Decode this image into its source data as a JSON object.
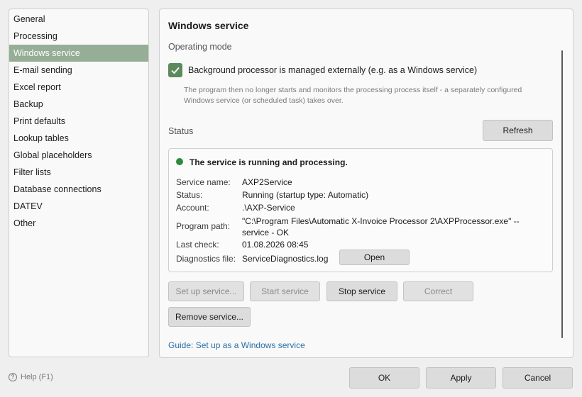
{
  "sidebar": {
    "items": [
      {
        "label": "General"
      },
      {
        "label": "Processing"
      },
      {
        "label": "Windows service"
      },
      {
        "label": "E-mail sending"
      },
      {
        "label": "Excel report"
      },
      {
        "label": "Backup"
      },
      {
        "label": "Print defaults"
      },
      {
        "label": "Lookup tables"
      },
      {
        "label": "Global placeholders"
      },
      {
        "label": "Filter lists"
      },
      {
        "label": "Database connections"
      },
      {
        "label": "DATEV"
      },
      {
        "label": "Other"
      }
    ],
    "active_index": 2
  },
  "panel": {
    "title": "Windows service",
    "operating_mode_label": "Operating mode",
    "checkbox": {
      "checked": true,
      "label": "Background processor is managed externally (e.g. as a Windows service)"
    },
    "hint": "The program then no longer starts and monitors the processing process itself - a separately configured Windows service (or scheduled task) takes over.",
    "status_label": "Status",
    "refresh_label": "Refresh",
    "status": {
      "headline": "The service is running and processing.",
      "indicator_color": "#2f8a3c",
      "service_name_key": "Service name:",
      "service_name": "AXP2Service",
      "status_key": "Status:",
      "status_value": "Running (startup type: Automatic)",
      "account_key": "Account:",
      "account": ".\\AXP-Service",
      "program_path_key": "Program path:",
      "program_path": "\"C:\\Program Files\\Automatic X-Invoice Processor 2\\AXPProcessor.exe\" --service - OK",
      "last_check_key": "Last check:",
      "last_check": "01.08.2026 08:45",
      "diagnostics_key": "Diagnostics file:",
      "diagnostics_file": "ServiceDiagnostics.log",
      "open_label": "Open"
    },
    "actions": {
      "setup": "Set up service...",
      "start": "Start service",
      "stop": "Stop service",
      "correct": "Correct",
      "remove": "Remove service..."
    },
    "guide_link": "Guide: Set up as a Windows service"
  },
  "footer": {
    "help_label": "Help (F1)",
    "ok": "OK",
    "apply": "Apply",
    "cancel": "Cancel"
  },
  "colors": {
    "accent": "#96ad96",
    "checkbox": "#5d8a5d",
    "link": "#2a6fa8"
  }
}
